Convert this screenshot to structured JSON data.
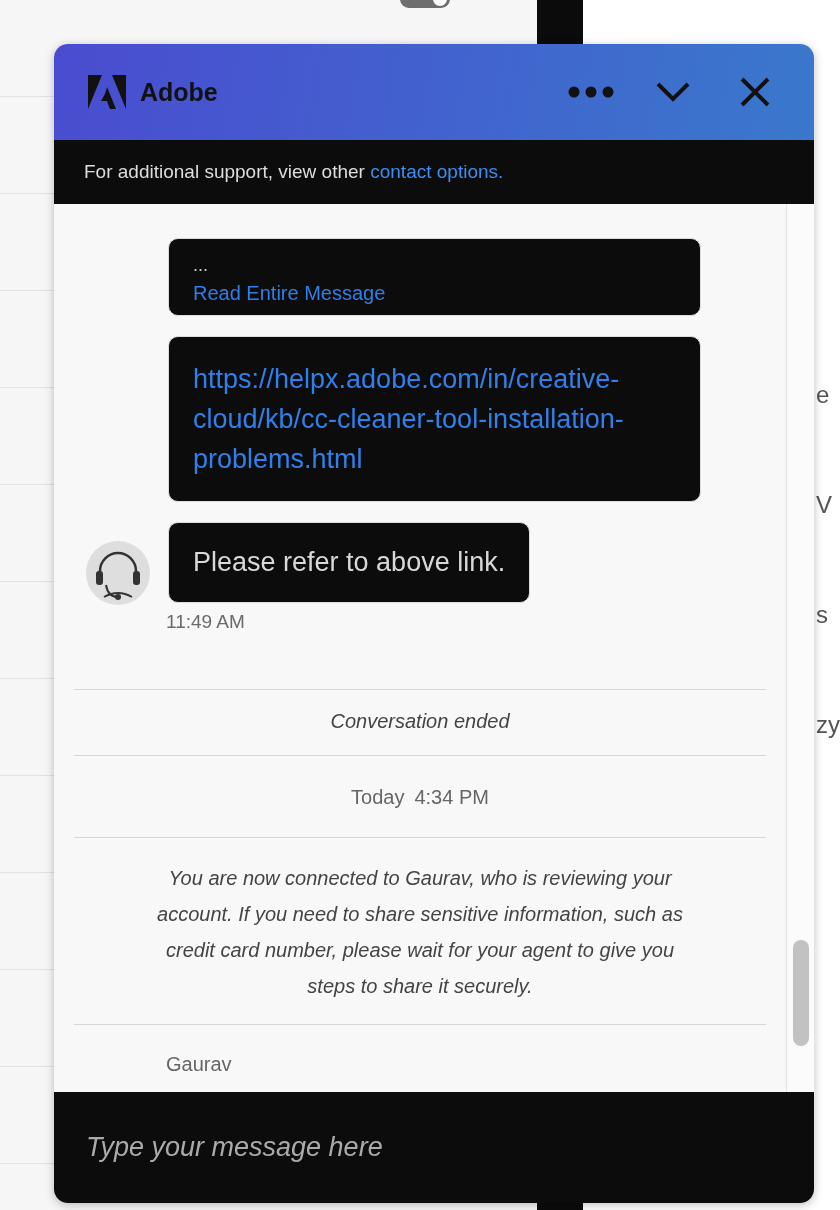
{
  "background": {
    "toggle": {
      "on": true
    },
    "side_text": [
      "e",
      "V",
      "s",
      "zy"
    ]
  },
  "header": {
    "logo_text": "Adobe"
  },
  "notice": {
    "text": "For additional support, view other ",
    "link": "contact options."
  },
  "messages": [
    {
      "kind": "bubble",
      "lines": [
        {
          "kind": "text",
          "text": "..."
        },
        {
          "kind": "link",
          "text": "Read Entire Message"
        }
      ]
    },
    {
      "kind": "link_bubble",
      "text": "https://helpx.adobe.com/in/creative-cloud/kb/cc-cleaner-tool-installation-problems.html"
    },
    {
      "kind": "agent_bubble",
      "text": "Please refer to above link.",
      "time": "11:49 AM"
    },
    {
      "kind": "status",
      "text": "Conversation ended"
    },
    {
      "kind": "date",
      "day": "Today",
      "time": "4:34 PM"
    },
    {
      "kind": "info",
      "text": "You are now connected to Gaurav, who is reviewing your account. If you need to share sensitive information, such as credit card number, please wait for your agent to give you steps to share it securely."
    },
    {
      "kind": "sender",
      "text": "Gaurav"
    }
  ],
  "composer": {
    "placeholder": "Type your message here"
  }
}
